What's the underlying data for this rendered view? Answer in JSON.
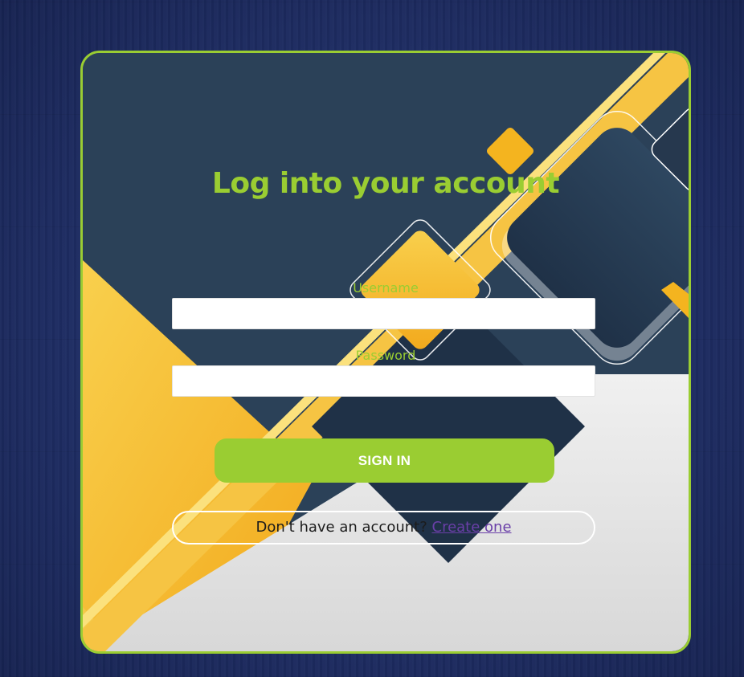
{
  "login": {
    "title": "Log into your account",
    "username_label": "Username",
    "username_value": "",
    "password_label": "Password",
    "password_value": "",
    "sign_in_label": "SIGN IN",
    "signup_prompt": "Don't have an account? ",
    "signup_link": "Create one"
  },
  "colors": {
    "accent": "#9acd32",
    "card_dark": "#2b4158",
    "gold": "#f5b82e",
    "light_gray": "#e6e6e6",
    "page_background": "#1f2f66",
    "link": "#6a3fa8"
  }
}
